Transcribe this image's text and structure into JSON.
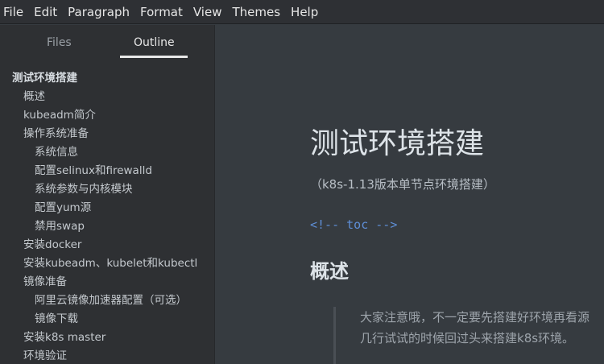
{
  "menu": {
    "items": [
      "File",
      "Edit",
      "Paragraph",
      "Format",
      "View",
      "Themes",
      "Help"
    ]
  },
  "sidebar": {
    "tabs": {
      "files": "Files",
      "outline": "Outline"
    },
    "outline": [
      {
        "label": "测试环境搭建",
        "level": 1
      },
      {
        "label": "概述",
        "level": 2
      },
      {
        "label": "kubeadm简介",
        "level": 2
      },
      {
        "label": "操作系统准备",
        "level": 2
      },
      {
        "label": "系统信息",
        "level": 3
      },
      {
        "label": "配置selinux和firewalld",
        "level": 3
      },
      {
        "label": "系统参数与内核模块",
        "level": 3
      },
      {
        "label": "配置yum源",
        "level": 3
      },
      {
        "label": "禁用swap",
        "level": 3
      },
      {
        "label": "安装docker",
        "level": 2
      },
      {
        "label": "安装kubeadm、kubelet和kubectl",
        "level": 2
      },
      {
        "label": "镜像准备",
        "level": 2
      },
      {
        "label": "阿里云镜像加速器配置（可选）",
        "level": 3
      },
      {
        "label": "镜像下载",
        "level": 3
      },
      {
        "label": "安装k8s master",
        "level": 2
      },
      {
        "label": "环境验证",
        "level": 2
      }
    ]
  },
  "editor": {
    "title": "测试环境搭建",
    "subtitle": "（k8s-1.13版本单节点环境搭建）",
    "toc_comment": "<!-- toc -->",
    "section_heading": "概述",
    "blockquote_lines": [
      "大家注意哦，不一定要先搭建好环境再看源",
      "几行试试的时候回过头来搭建k8s环境。"
    ]
  }
}
